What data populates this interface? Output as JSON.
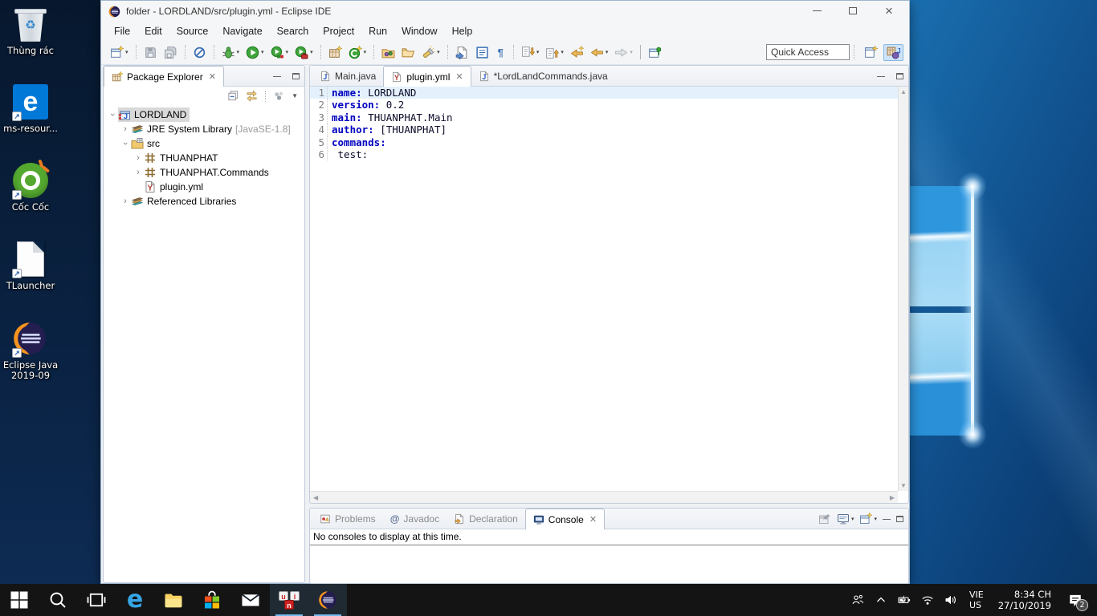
{
  "desktop": {
    "icons": [
      {
        "label": "Thùng rác"
      },
      {
        "label": "ms-resour..."
      },
      {
        "label": "Cốc Cốc"
      },
      {
        "label": "TLauncher"
      },
      {
        "label": "Eclipse Java 2019-09"
      }
    ]
  },
  "window": {
    "title": "folder - LORDLAND/src/plugin.yml - Eclipse IDE",
    "menus": [
      "File",
      "Edit",
      "Source",
      "Navigate",
      "Search",
      "Project",
      "Run",
      "Window",
      "Help"
    ],
    "quick_access_placeholder": "Quick Access"
  },
  "toolbar": {
    "icons": [
      "new",
      "save",
      "save-all",
      "skip-all-breakpoints",
      "debug",
      "run",
      "coverage",
      "run-external-tools",
      "new-java-project",
      "new-java-class",
      "open-type",
      "open-resource",
      "search",
      "open-element",
      "show-source",
      "show-whitespace",
      "next-annotation",
      "previous-annotation",
      "last-edit-location",
      "back",
      "forward",
      "pin-editor",
      "open-perspective",
      "java-perspective"
    ]
  },
  "package_explorer": {
    "title": "Package Explorer",
    "toolbar_icons": [
      "collapse-all",
      "link-with-editor",
      "focus",
      "view-menu"
    ],
    "tree": [
      {
        "label": "LORDLAND"
      },
      {
        "label": "JRE System Library",
        "suffix": "[JavaSE-1.8]"
      },
      {
        "label": "src"
      },
      {
        "label": "THUANPHAT"
      },
      {
        "label": "THUANPHAT.Commands"
      },
      {
        "label": "plugin.yml"
      },
      {
        "label": "Referenced Libraries"
      }
    ]
  },
  "editor": {
    "tabs": [
      {
        "label": "Main.java"
      },
      {
        "label": "plugin.yml"
      },
      {
        "label": "*LordLandCommands.java"
      }
    ],
    "lines": [
      {
        "num": "1",
        "key": "name:",
        "value": " LORDLAND"
      },
      {
        "num": "2",
        "key": "version:",
        "value": " 0.2"
      },
      {
        "num": "3",
        "key": "main:",
        "value": " THUANPHAT.Main"
      },
      {
        "num": "4",
        "key": "author:",
        "value": " [THUANPHAT]"
      },
      {
        "num": "5",
        "key": "commands:",
        "value": ""
      },
      {
        "num": "6",
        "key": "",
        "value": " test:"
      }
    ]
  },
  "console": {
    "tabs": [
      "Problems",
      "Javadoc",
      "Declaration",
      "Console"
    ],
    "message": "No consoles to display at this time.",
    "toolbar_icons": [
      "pin-console",
      "display-selected-console",
      "open-console",
      "minimize",
      "maximize"
    ]
  },
  "taskbar": {
    "apps": [
      "start",
      "search",
      "task-view",
      "edge",
      "file-explorer",
      "store",
      "mail",
      "unikey",
      "eclipse"
    ],
    "running_apps": [
      "unikey",
      "eclipse"
    ],
    "tray_icons": [
      "people",
      "hidden-icons",
      "battery",
      "network",
      "volume"
    ],
    "tray": {
      "lang_top": "VIE",
      "lang_bottom": "US",
      "time": "8:34 CH",
      "date": "27/10/2019",
      "notification_count": "2"
    }
  },
  "colors": {
    "accent": "#0078d7",
    "taskbar": "#141414",
    "current_line": "#e4f1fd",
    "yaml_key": "#0000c0",
    "selection": "#d9d9d9"
  }
}
